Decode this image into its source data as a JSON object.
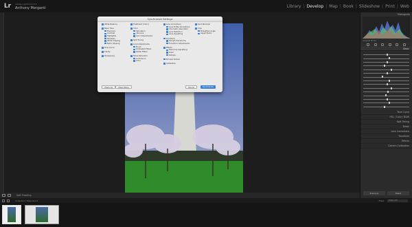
{
  "topbar": {
    "subtitle": "Adobe Lightroom 5.3",
    "user": "Anthony Morganti",
    "modules": [
      "Library",
      "Develop",
      "Map",
      "Book",
      "Slideshow",
      "Print",
      "Web"
    ],
    "active_module": "Develop"
  },
  "dialog": {
    "title": "Synchronize Settings",
    "columns": [
      [
        {
          "label": "White Balance",
          "sub": false
        },
        {
          "label": "Basic Tone",
          "sub": false
        },
        {
          "label": "Exposure",
          "sub": true
        },
        {
          "label": "Contrast",
          "sub": true
        },
        {
          "label": "Highlights",
          "sub": true
        },
        {
          "label": "Shadows",
          "sub": true
        },
        {
          "label": "White Clipping",
          "sub": true
        },
        {
          "label": "Black Clipping",
          "sub": true
        },
        {
          "label": "Tone Curve",
          "sub": false
        },
        {
          "label": "Clarity",
          "sub": false
        },
        {
          "label": "Sharpening",
          "sub": false
        }
      ],
      [
        {
          "label": "Treatment (Color)",
          "sub": false
        },
        {
          "label": "Color",
          "sub": false
        },
        {
          "label": "Saturation",
          "sub": true
        },
        {
          "label": "Vibrance",
          "sub": true
        },
        {
          "label": "Color Adjustments",
          "sub": true
        },
        {
          "label": "Split Toning",
          "sub": false
        },
        {
          "label": "Local Adjustments",
          "sub": false
        },
        {
          "label": "Brush",
          "sub": true
        },
        {
          "label": "Graduated Filters",
          "sub": true
        },
        {
          "label": "Radial Filters",
          "sub": true
        },
        {
          "label": "Noise Reduction",
          "sub": false
        },
        {
          "label": "Luminance",
          "sub": true
        },
        {
          "label": "Color",
          "sub": true
        }
      ],
      [
        {
          "label": "Lens Corrections",
          "sub": false
        },
        {
          "label": "Lens Profile Corrections",
          "sub": true
        },
        {
          "label": "Chromatic Aberration",
          "sub": true
        },
        {
          "label": "Lens Distortion",
          "sub": true
        },
        {
          "label": "Lens Vignetting",
          "sub": true
        },
        {
          "label": "Transform",
          "sub": false
        },
        {
          "label": "Upright Transforms",
          "sub": true
        },
        {
          "label": "Transform Adjustments",
          "sub": true
        },
        {
          "label": "Effects",
          "sub": false
        },
        {
          "label": "Post-Crop Vignetting",
          "sub": true
        },
        {
          "label": "Grain",
          "sub": true
        },
        {
          "label": "Dehaze",
          "sub": true
        },
        {
          "label": "Process Version",
          "sub": false
        },
        {
          "label": "Calibration",
          "sub": false
        }
      ],
      [
        {
          "label": "Spot Removal",
          "sub": false
        },
        {
          "label": "Crop",
          "sub": false
        },
        {
          "label": "Straighten Angle",
          "sub": true
        },
        {
          "label": "Aspect Ratio",
          "sub": true
        }
      ]
    ],
    "buttons": {
      "check_all": "Check All",
      "check_none": "Check None",
      "cancel": "Cancel",
      "synchronize": "Synchronize"
    }
  },
  "right_panel": {
    "histogram_label": "Histogram",
    "meta": "Original Photo",
    "basic_label": "Basic",
    "sections": [
      "Tone Curve",
      "HSL / Color / B&W",
      "Split Toning",
      "Detail",
      "Lens Corrections",
      "Transform",
      "Effects",
      "Camera Calibration"
    ],
    "previous": "Previous",
    "reset": "Reset"
  },
  "toolbar": {
    "label": "Soft Proofing"
  },
  "filmbar": {
    "crumb": "Collection: Episode 41",
    "filter": "Filter:",
    "filter_value": "Filters Off"
  }
}
